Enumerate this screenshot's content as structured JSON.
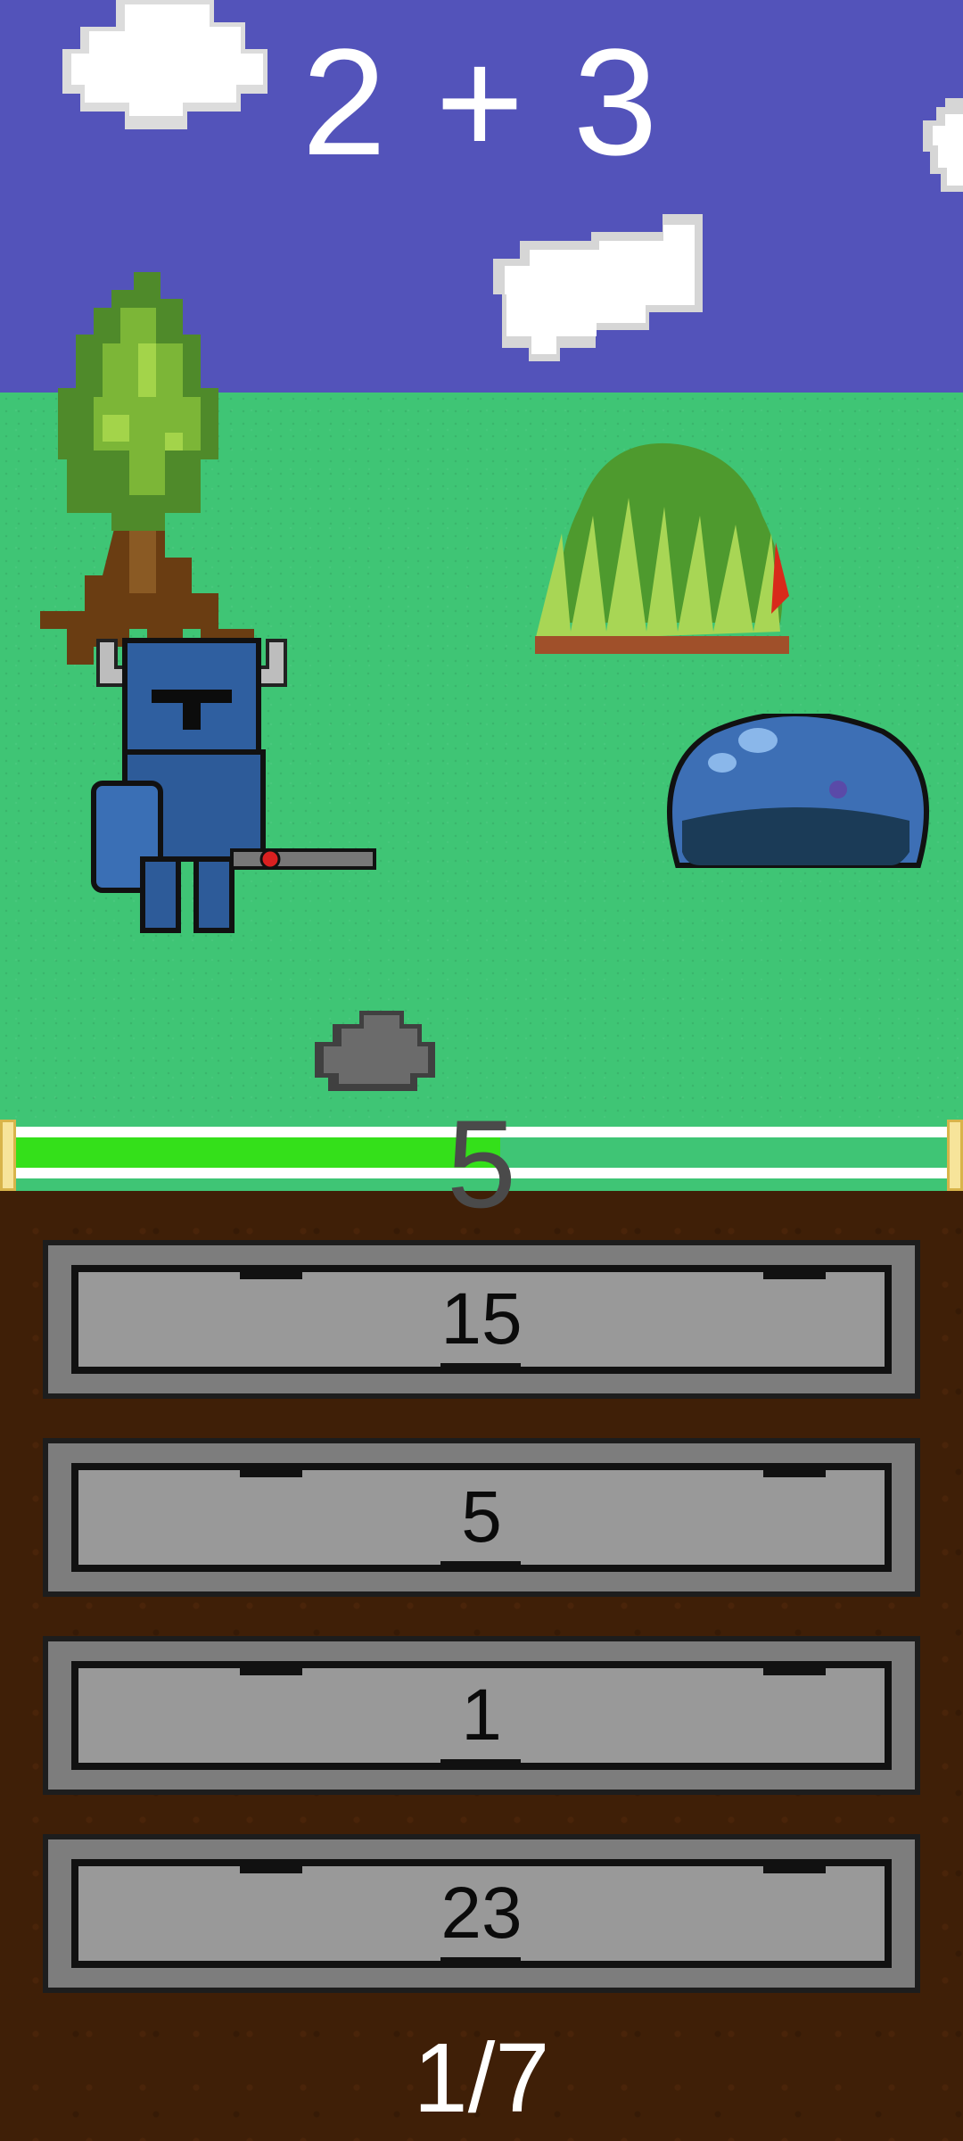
{
  "question": {
    "text": "2 + 3"
  },
  "typed_answer": "5",
  "timer": {
    "fill_fraction": 0.52
  },
  "choices": [
    {
      "label": "15"
    },
    {
      "label": "5"
    },
    {
      "label": "1"
    },
    {
      "label": "23"
    }
  ],
  "progress": {
    "text": "1/7",
    "current": 1,
    "total": 7
  },
  "sprites": {
    "player": "knight-icon",
    "enemy": "slime-icon",
    "decor": [
      "tree-icon",
      "bush-icon",
      "rock-icon",
      "cloud-icon"
    ]
  },
  "colors": {
    "sky": "#5353ba",
    "grass": "#3fc575",
    "ground": "#3f1f07",
    "timer_fill": "#34e01a"
  }
}
